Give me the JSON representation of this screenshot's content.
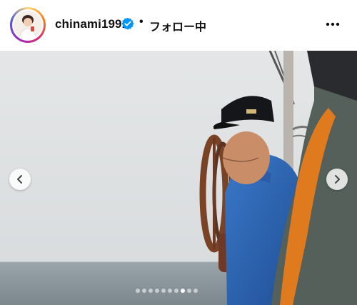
{
  "post_header": {
    "username": "chinami1991",
    "separator": "•",
    "follow_status": "フォロー中"
  },
  "carousel": {
    "slide_count": 10,
    "active_index": 7
  },
  "icons": {
    "verified": "verified-badge-icon",
    "more": "more-options-icon",
    "prev": "chevron-left-icon",
    "next": "chevron-right-icon"
  },
  "colors": {
    "verified_blue": "#0095f6",
    "text": "#111111"
  }
}
